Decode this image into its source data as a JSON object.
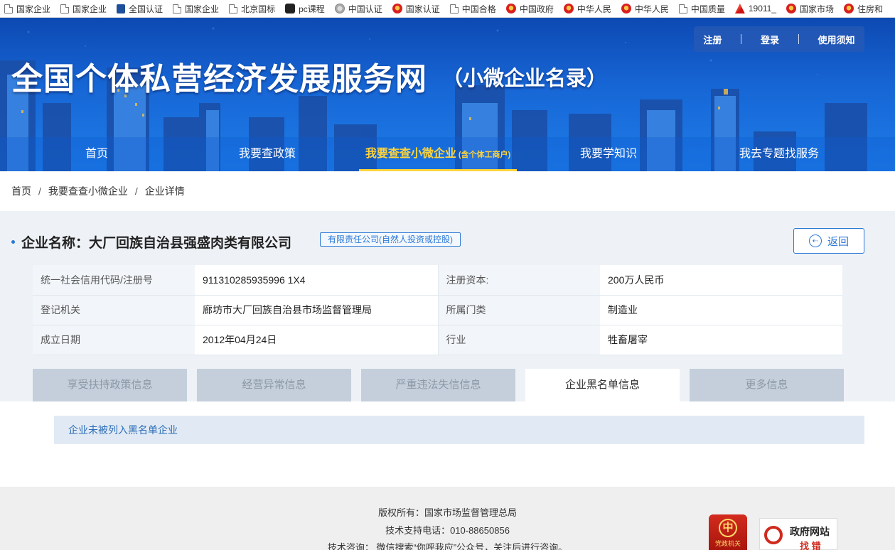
{
  "bookmarks": [
    {
      "label": "国家企业",
      "icon": "document-icon"
    },
    {
      "label": "国家企业",
      "icon": "document-icon"
    },
    {
      "label": "全国认证",
      "icon": "cnca-icon"
    },
    {
      "label": "国家企业",
      "icon": "document-icon"
    },
    {
      "label": "北京国标",
      "icon": "document-icon"
    },
    {
      "label": "pc课程",
      "icon": "pc-icon"
    },
    {
      "label": "中国认证",
      "icon": "globe-icon"
    },
    {
      "label": "国家认证",
      "icon": "emblem-icon"
    },
    {
      "label": "中国合格",
      "icon": "document-icon"
    },
    {
      "label": "中国政府",
      "icon": "emblem-icon"
    },
    {
      "label": "中华人民",
      "icon": "emblem-icon"
    },
    {
      "label": "中华人民",
      "icon": "emblem-icon"
    },
    {
      "label": "中国质量",
      "icon": "document-icon"
    },
    {
      "label": "19011_",
      "icon": "red-logo-icon"
    },
    {
      "label": "国家市场",
      "icon": "emblem-icon"
    },
    {
      "label": "住房和",
      "icon": "emblem-icon"
    }
  ],
  "header": {
    "title": "全国个体私营经济发展服务网",
    "subtitle": "（小微企业名录）",
    "auth": {
      "register": "注册",
      "login": "登录",
      "guide": "使用须知"
    }
  },
  "nav": {
    "home": "首页",
    "policy": "我要查政策",
    "search": "我要查查小微企业",
    "search_note": "(含个体工商户)",
    "learn": "我要学知识",
    "service": "我去专题找服务"
  },
  "breadcrumb": {
    "home": "首页",
    "search": "我要查查小微企业",
    "detail": "企业详情",
    "sep": "/"
  },
  "company": {
    "name_label": "企业名称：大厂回族自治县强盛肉类有限公司",
    "type": "有限责任公司(自然人投资或控股)",
    "back_label": "返回",
    "fields": {
      "credit_code_label": "统一社会信用代码/注册号",
      "credit_code": "911310285935996 1X4",
      "capital_label": "注册资本:",
      "capital": "200万人民币",
      "authority_label": "登记机关",
      "authority": "廊坊市大厂回族自治县市场监督管理局",
      "category_label": "所属门类",
      "category": "制造业",
      "date_label": "成立日期",
      "date": "2012年04月24日",
      "industry_label": "行业",
      "industry": "牲畜屠宰"
    }
  },
  "tabs": [
    "享受扶持政策信息",
    "经营异常信息",
    "严重违法失信信息",
    "企业黑名单信息",
    "更多信息"
  ],
  "active_tab": 3,
  "result_text": "企业未被列入黑名单企业",
  "footer": {
    "copyright": "版权所有：国家市场监督管理总局",
    "support": "技术支持电话：010-88650856",
    "consult": "技术咨询： 微信搜索“你呼我应”公众号，关注后进行咨询。",
    "badge1_text": "党政机关",
    "badge2_title": "政府网站",
    "badge2_sub": "找 错"
  },
  "colors": {
    "banner": "#1766d6",
    "accent": "#2b78d6",
    "active_nav": "#ffd43b"
  }
}
